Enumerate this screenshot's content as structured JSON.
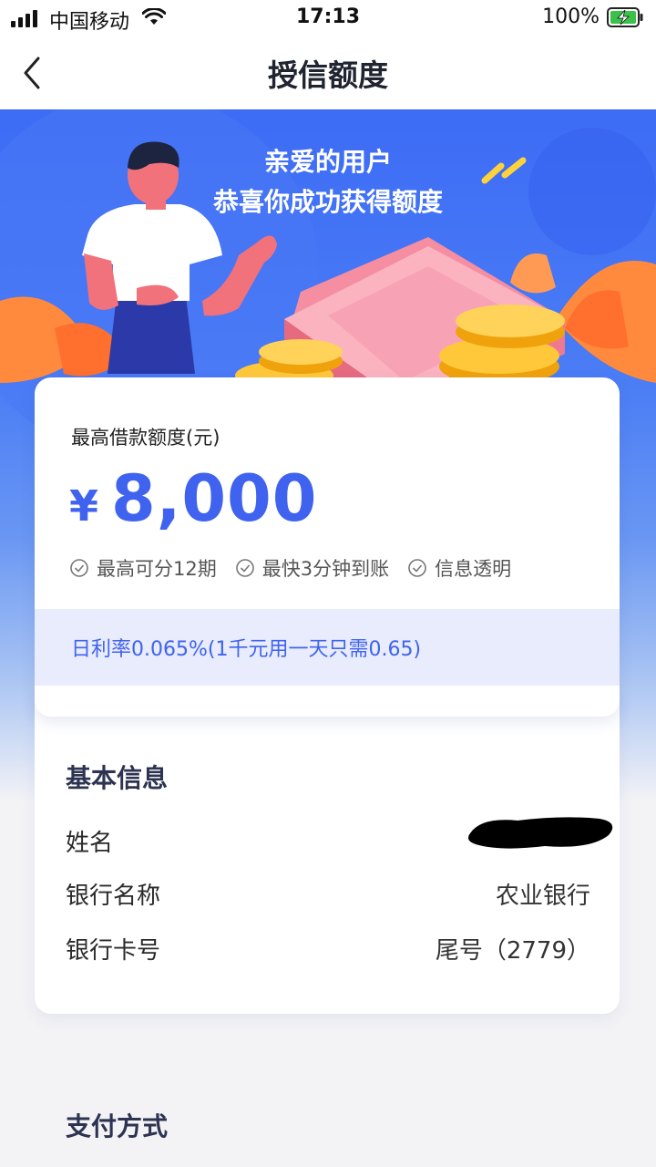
{
  "status_bar": {
    "carrier": "中国移动",
    "time": "17:13",
    "battery": "100%"
  },
  "nav": {
    "title": "授信额度",
    "back_icon": "chevron-left-icon"
  },
  "hero": {
    "line1": "亲爱的用户",
    "line2": "恭喜你成功获得额度"
  },
  "limit_card": {
    "label": "最高借款额度(元)",
    "currency": "¥",
    "amount": "8,000",
    "features": [
      "最高可分12期",
      "最快3分钟到账",
      "信息透明"
    ],
    "rate_text": "日利率0.065%(1千元用一天只需0.65)"
  },
  "basic_info": {
    "title": "基本信息",
    "rows": [
      {
        "label": "姓名",
        "value": ""
      },
      {
        "label": "银行名称",
        "value": "农业银行"
      },
      {
        "label": "银行卡号",
        "value": "尾号（2779）"
      }
    ]
  },
  "payment": {
    "title": "支付方式"
  },
  "colors": {
    "accent": "#4063ef",
    "hero_blue": "#3d6cf5",
    "rate_bg": "#e8ecfd"
  }
}
